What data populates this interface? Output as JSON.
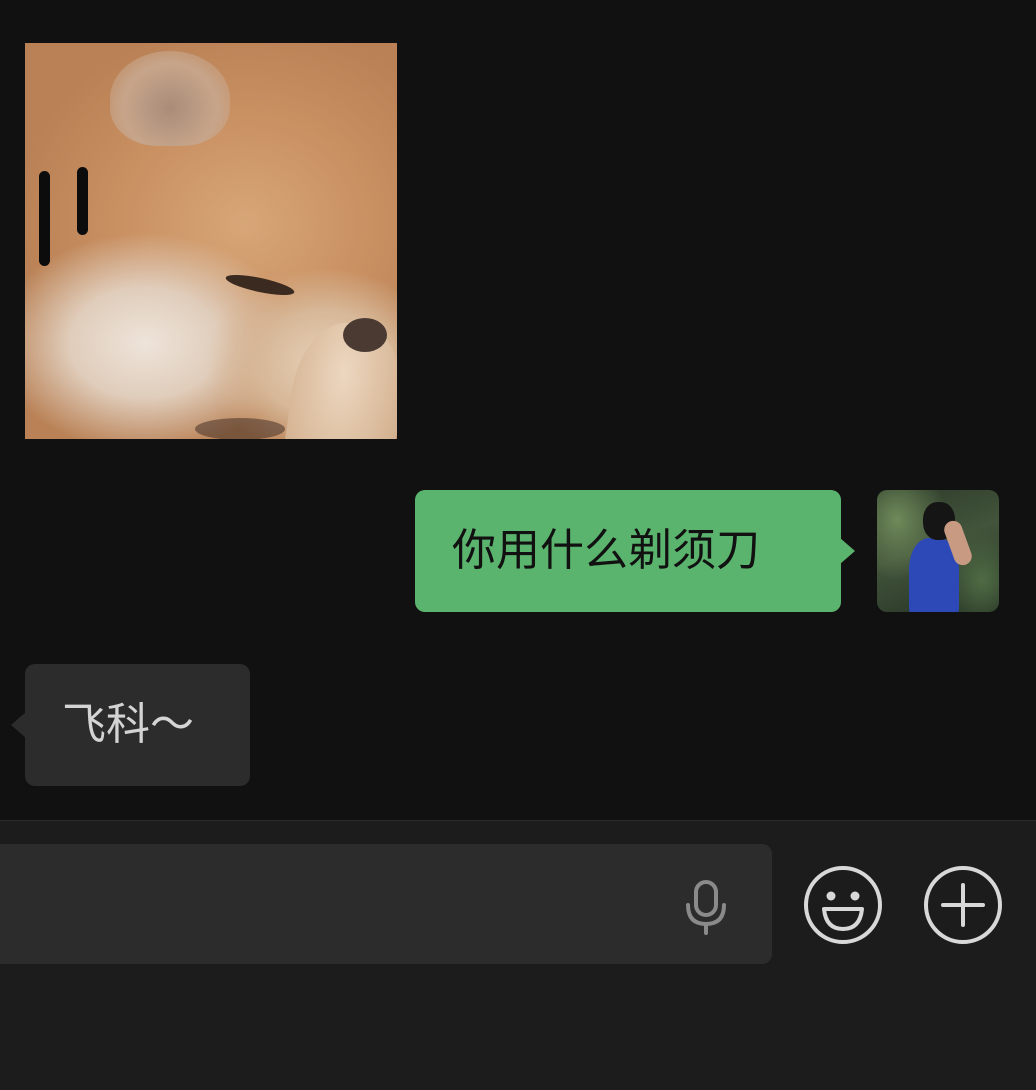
{
  "theme": {
    "background": "#111111",
    "sent_bubble": "#5bb46e",
    "received_bubble": "#2c2c2c",
    "input_bar": "#1c1c1c",
    "icon_color": "#d8d8d8"
  },
  "messages": [
    {
      "direction": "received",
      "type": "sticker",
      "icon": "shiba-dog-covering-nose-sticker"
    },
    {
      "direction": "sent",
      "type": "text",
      "text": "你用什么剃须刀"
    },
    {
      "direction": "received",
      "type": "text",
      "text": "飞科～"
    }
  ],
  "input_bar": {
    "message_value": "",
    "voice_icon": "microphone-icon",
    "emoji_icon": "smiley-face-icon",
    "more_icon": "plus-circle-icon"
  }
}
